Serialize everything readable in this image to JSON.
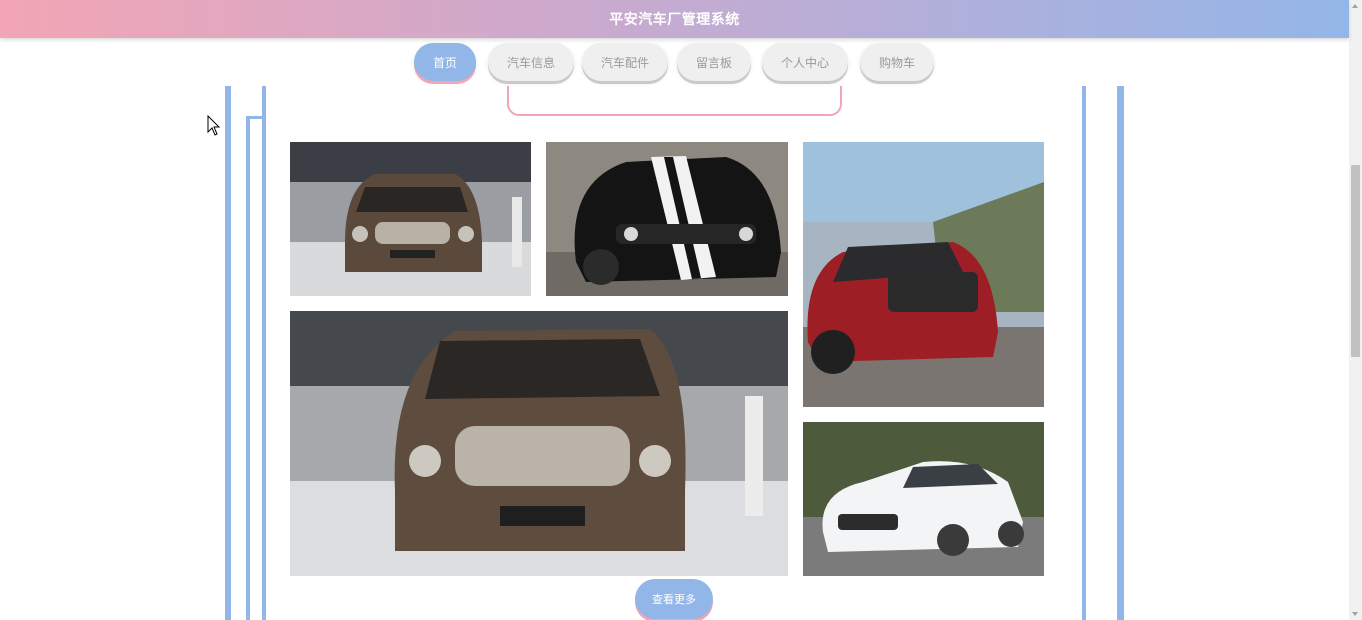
{
  "header": {
    "title": "平安汽车厂管理系统"
  },
  "nav": {
    "items": [
      {
        "label": "首页",
        "active": true
      },
      {
        "label": "汽车信息",
        "active": false
      },
      {
        "label": "汽车配件",
        "active": false
      },
      {
        "label": "留言板",
        "active": false
      },
      {
        "label": "个人中心",
        "active": false
      },
      {
        "label": "购物车",
        "active": false
      }
    ]
  },
  "gallery": {
    "photos": [
      {
        "subject": "brown MPV at auto show"
      },
      {
        "subject": "black muscle car with white stripes"
      },
      {
        "subject": "red SUV driving"
      },
      {
        "subject": "brown MPV at auto show, close-up"
      },
      {
        "subject": "white sedan"
      }
    ],
    "more_label": "查看更多"
  },
  "colors": {
    "accent_blue": "#93b6e8",
    "accent_pink": "#f2a5b4"
  }
}
